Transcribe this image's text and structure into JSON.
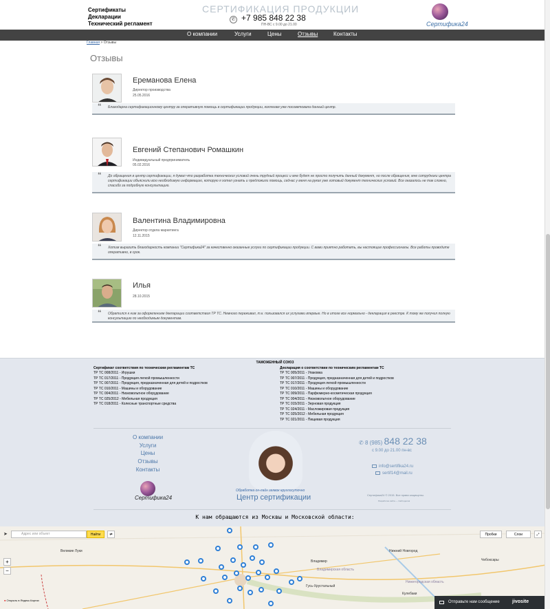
{
  "header": {
    "links": [
      "Сертификаты",
      "Декларации",
      "Технический регламент"
    ],
    "title": "СЕРТИФИКАЦИЯ ПРОДУКЦИИ",
    "phone": "+7 985 848 22 38",
    "hours": "ПН-ВС  с 9.00 до 21.00",
    "logo_text": "Сертифика24"
  },
  "nav": [
    {
      "label": "О компании"
    },
    {
      "label": "Услуги"
    },
    {
      "label": "Цены"
    },
    {
      "label": "Отзывы",
      "active": true
    },
    {
      "label": "Контакты"
    }
  ],
  "breadcrumb": {
    "home": "Главная",
    "sep": " > ",
    "current": "Отзывы"
  },
  "page_title": "Отзывы",
  "reviews": [
    {
      "name": "Ереманова Елена",
      "position": "Директор производства",
      "date": "25.05.2016",
      "text": "Благодарна сертификационному центру за оперативную помощь в сертификации продукции, коллегам уже посоветовала данный центр."
    },
    {
      "name": "Евгений Степанович Ромашкин",
      "position": "Индивидуальный предприниматель",
      "date": "05.02.2016",
      "text": "До обращения в центр сертификации, я думал что разработка технических условий очень трудный процесс и мне будет не просто получить данный документ, но после обращения, мне сотрудники центра сертификации объяснили всю необходимую информацию, которую я хотел узнать и предложили помощь, сейчас у меня на руках уже готовый документ технических условий. Все оказалось не так сложно, спасибо за подробную консультацию."
    },
    {
      "name": "Валентина Владимировна",
      "position": "Директор отдела маркетинга",
      "date": "12.11.2015",
      "text": "Хотим выразить благодарность компании \"Сертифика24\" за качественно оказанные услуги по сертификации продукции. С вами приятно работать, вы настоящие профессионалы. Все работы проводите оперативно, в срок."
    },
    {
      "name": "Илья",
      "position": "",
      "date": "28.10.2015",
      "text": "Обратился к ним за оформлением декларации соответствия ТР ТС. Немного переживал, т.к. пользовался их услугами впервые. Но в итоге все нормально - декларация в реестре. К тому же получил полную консультацию по необходимым документам."
    }
  ],
  "footer": {
    "customs_title": "ТАМОЖЕННЫЙ СОЮЗ",
    "left_title": "Сертификат соответствия по техническим регламентам ТС",
    "left_items": [
      "ТР ТС 008/2011 - Игрушки",
      "ТР ТС 017/2011 - Продукция легкой промышленности",
      "ТР ТС 007/2011 - Продукция, предназначенная для детей и подростков",
      "ТР ТС 010/2011 - Машины и оборудование",
      "ТР ТС 004/2011 - Низковольтное оборудование",
      "ТР ТС 025/2012 - Мебельная продукция",
      "ТР ТС 018/2011 - Колесные транспортные средства"
    ],
    "right_title": "Декларация о соответствии по техническим регламентам ТС",
    "right_items": [
      "ТР ТС 005/2011 - Упаковка",
      "ТР ТС 007/2011 - Продукция, предназначенная для детей и подростков",
      "ТР ТС 017/2011 - Продукция легкой промышленности",
      "ТР ТС 010/2011 - Машины и оборудование",
      "ТР ТС 009/2011 - Парфюмерно-косметическая продукция",
      "ТР ТС 004/2011 - Низковольтное оборудование",
      "ТР ТС 015/2011 - Зерновая продукция",
      "ТР ТС 024/2011 - Масложировая продукция",
      "ТР ТС 025/2012 - Мебельная продукция",
      "ТР ТС 021/2011 - Пищевая продукция"
    ],
    "nav": [
      "О компании",
      "Услуги",
      "Цены",
      "Отзывы",
      "Контакты"
    ],
    "logo_text": "Сертифика24",
    "operator_caption": "Обработка он-лайн заявок круглосуточно",
    "operator_center": "Центр сертификации",
    "phone_prefix": "8 (985) ",
    "phone_number": "848 22 38",
    "hours": "с 9.00 до 21.00 пн-вс",
    "email1": "info@sertifika24.ru",
    "email2": "sertif14@mail.ru",
    "copyright": "Сертифика24 © 2015. Все права защищены.",
    "copyright2": "Разработка сайта — Сайтоделов",
    "map_title": "К нам обращаются из Москвы и Московской области:"
  },
  "map": {
    "search_placeholder": "Адрес или объект",
    "find_label": "Найти",
    "traffic_label": "Пробки",
    "layers_label": "Слои",
    "cities": [
      "Великие Луки",
      "Владимир",
      "Нижний Новгород",
      "Чебоксары",
      "Владимирская область",
      "Нижегородская область",
      "Гусь-Хрустальный",
      "Кулебаки"
    ],
    "open_link": "Открыть в Яндекс.Картах"
  },
  "chat": {
    "label": "Отправьте нам сообщение",
    "brand": "jivosite"
  }
}
